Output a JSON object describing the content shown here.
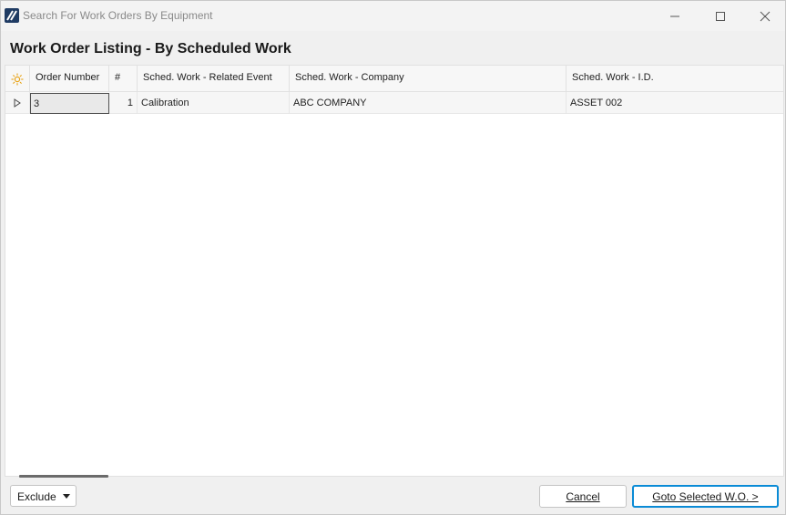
{
  "window": {
    "title": "Search For Work Orders By Equipment",
    "icon": "app-logo-icon"
  },
  "controls": {
    "minimize_icon": "minimize-icon",
    "maximize_icon": "maximize-icon",
    "close_icon": "close-icon"
  },
  "page": {
    "title": "Work Order Listing - By Scheduled Work"
  },
  "grid": {
    "settings_icon": "sun-settings-icon",
    "columns": [
      "Order Number",
      "#",
      "Sched. Work - Related Event",
      "Sched. Work - Company",
      "Sched. Work - I.D."
    ],
    "rows": [
      {
        "order_number": "3",
        "num": "1",
        "related_event": "Calibration",
        "company": "ABC COMPANY",
        "id": "ASSET 002"
      }
    ]
  },
  "footer": {
    "exclude_label": "Exclude",
    "cancel_label": "Cancel",
    "goto_label": "Goto Selected W.O. >"
  },
  "colors": {
    "accent": "#0a8bd6",
    "logo": "#1f3b63",
    "settings_icon": "#e8a317"
  }
}
